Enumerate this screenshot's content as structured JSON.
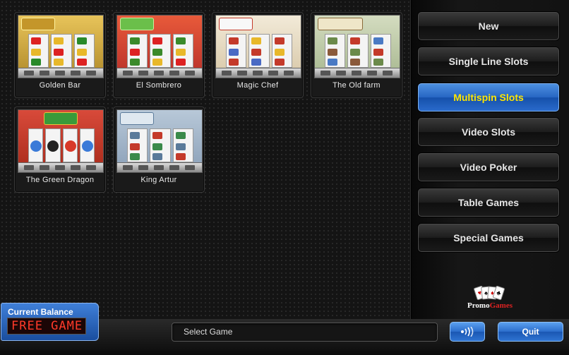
{
  "games": [
    {
      "label": "Golden Bar",
      "icon": "golden-bar-thumbnail",
      "sky": "#d9b54a",
      "accent": "#8a5b1a",
      "logo": "#c4962a"
    },
    {
      "label": "El Sombrero",
      "icon": "el-sombrero-thumbnail",
      "sky": "#d94a3a",
      "accent": "#3a8a2a",
      "logo": "#6bbf4a"
    },
    {
      "label": "Magic Chef",
      "icon": "magic-chef-thumbnail",
      "sky": "#e8dcc8",
      "accent": "#c43a2a",
      "logo": "#f2f2f2"
    },
    {
      "label": "The Old farm",
      "icon": "old-farm-thumbnail",
      "sky": "#b9c9a5",
      "accent": "#6b8a4a",
      "logo": "#e8e0c8"
    },
    {
      "label": "The Green Dragon",
      "icon": "green-dragon-thumbnail",
      "sky": "#c43a2a",
      "accent": "#3a9a3a",
      "logo": "#e8c43a"
    },
    {
      "label": "King Artur",
      "icon": "king-artur-thumbnail",
      "sky": "#9ab0c8",
      "accent": "#5a7a9a",
      "logo": "#dfe8f0"
    }
  ],
  "nav": [
    {
      "label": "New",
      "active": false
    },
    {
      "label": "Single Line Slots",
      "active": false
    },
    {
      "label": "Multispin Slots",
      "active": true
    },
    {
      "label": "Video Slots",
      "active": false
    },
    {
      "label": "Video Poker",
      "active": false
    },
    {
      "label": "Table Games",
      "active": false
    },
    {
      "label": "Special Games",
      "active": false
    }
  ],
  "balance": {
    "label": "Current Balance",
    "value": "FREE GAME"
  },
  "ticker": {
    "text": "Select Game"
  },
  "buttons": {
    "sound_icon": "sound-waves-icon",
    "quit_label": "Quit"
  },
  "brand": {
    "name_part1": "Promo",
    "name_part2": "Games",
    "icon": "playing-cards-logo"
  },
  "colors": {
    "accent_blue": "#2b6dcb",
    "active_text": "#ffe600",
    "balance_red": "#ff3a2a"
  }
}
